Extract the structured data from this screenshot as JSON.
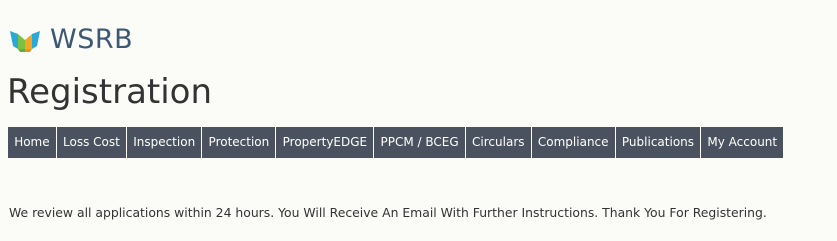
{
  "logo": {
    "text": "WSRB",
    "colors": [
      "#f5a623",
      "#7cc242",
      "#2aa9d6",
      "#3c5874"
    ]
  },
  "page": {
    "title": "Registration"
  },
  "nav": {
    "items": [
      {
        "label": "Home"
      },
      {
        "label": "Loss Cost"
      },
      {
        "label": "Inspection"
      },
      {
        "label": "Protection"
      },
      {
        "label": "PropertyEDGE"
      },
      {
        "label": "PPCM / BCEG"
      },
      {
        "label": "Circulars"
      },
      {
        "label": "Compliance"
      },
      {
        "label": "Publications"
      },
      {
        "label": "My Account"
      }
    ],
    "background_color": "#49525e",
    "text_color": "#ffffff"
  },
  "main": {
    "message": "We review all applications within 24 hours. You Will Receive An Email With Further Instructions. Thank You For Registering."
  }
}
